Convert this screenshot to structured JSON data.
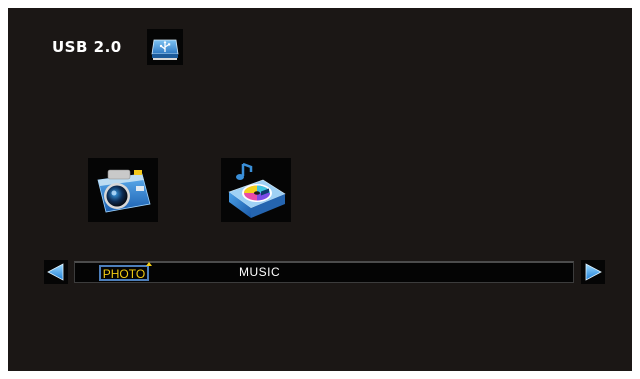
{
  "header": {
    "source_label": "USB 2.0",
    "source_icon": "usb-drive-icon"
  },
  "apps": [
    {
      "icon": "camera-icon"
    },
    {
      "icon": "music-player-icon"
    }
  ],
  "menu": {
    "items": [
      {
        "label": "PHOTO",
        "selected": true
      },
      {
        "label": "MUSIC",
        "selected": false
      }
    ],
    "nav_left_icon": "arrow-left-icon",
    "nav_right_icon": "arrow-right-icon"
  },
  "colors": {
    "background": "#1b1715",
    "selected_text": "#f2cc14",
    "selection_border": "#4d7fbb",
    "accent_blue": "#2f7fd4"
  }
}
